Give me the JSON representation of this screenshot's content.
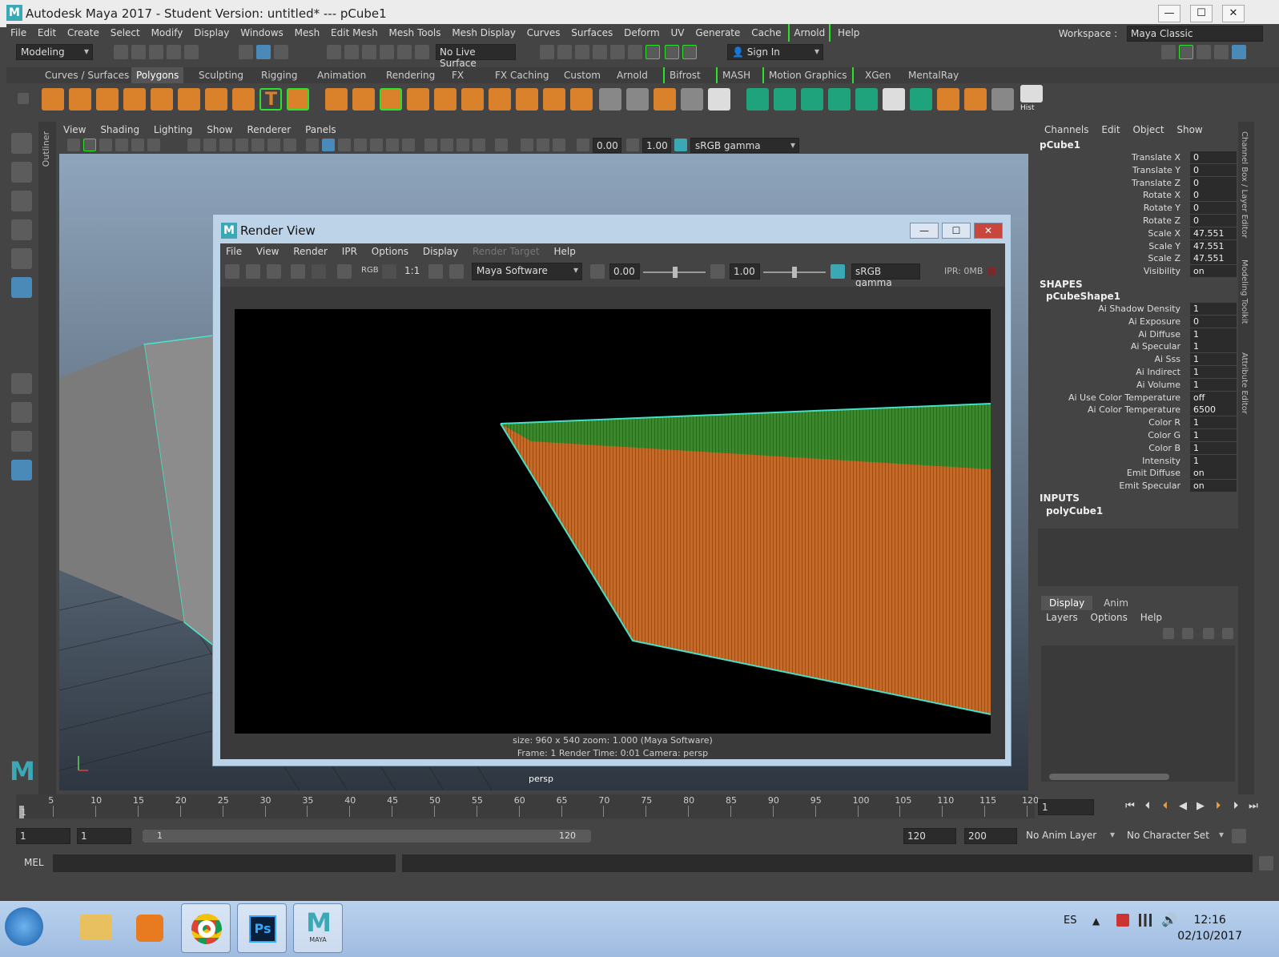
{
  "window": {
    "title": "Autodesk Maya 2017 - Student Version: untitled*   ---   pCube1",
    "logo": "M",
    "minimize": "—",
    "maximize": "☐",
    "close": "✕"
  },
  "menus": {
    "main": [
      "File",
      "Edit",
      "Create",
      "Select",
      "Modify",
      "Display",
      "Windows",
      "Mesh",
      "Edit Mesh",
      "Mesh Tools",
      "Mesh Display",
      "Curves",
      "Surfaces",
      "Deform",
      "UV",
      "Generate",
      "Cache",
      "Arnold",
      "Help"
    ],
    "workspace_label": "Workspace :",
    "workspace_value": "Maya Classic"
  },
  "statusline": {
    "mode": "Modeling",
    "live_surface": "No Live Surface",
    "sign_in": "Sign In"
  },
  "shelf": {
    "tabs": [
      "Curves / Surfaces",
      "Polygons",
      "Sculpting",
      "Rigging",
      "Animation",
      "Rendering",
      "FX",
      "FX Caching",
      "Custom",
      "Arnold",
      "Bifrost",
      "MASH",
      "Motion Graphics",
      "XGen",
      "MentalRay"
    ],
    "active_tab": "Polygons",
    "hist_label": "Hist"
  },
  "outliner_tab": "Outliner",
  "viewport": {
    "menu": [
      "View",
      "Shading",
      "Lighting",
      "Show",
      "Renderer",
      "Panels"
    ],
    "exposure": "0.00",
    "gamma": "1.00",
    "colorspace": "sRGB gamma",
    "camera_label": "persp"
  },
  "render_view": {
    "title": "Render View",
    "menu": [
      "File",
      "View",
      "Render",
      "IPR",
      "Options",
      "Display",
      "Render Target",
      "Help"
    ],
    "renderer": "Maya Software",
    "exposure": "0.00",
    "gamma": "1.00",
    "colorspace": "sRGB gamma",
    "ipr_memory": "IPR: 0MB",
    "rgb_label": "RGB",
    "ratio_label": "1:1",
    "info_line1": "size: 960 x 540  zoom: 1.000        (Maya Software)",
    "info_line2": "Frame: 1        Render Time: 0:01        Camera: persp"
  },
  "channel_box": {
    "menu": [
      "Channels",
      "Edit",
      "Object",
      "Show"
    ],
    "object": "pCube1",
    "transform": [
      {
        "label": "Translate X",
        "value": "0"
      },
      {
        "label": "Translate Y",
        "value": "0"
      },
      {
        "label": "Translate Z",
        "value": "0"
      },
      {
        "label": "Rotate X",
        "value": "0"
      },
      {
        "label": "Rotate Y",
        "value": "0"
      },
      {
        "label": "Rotate Z",
        "value": "0"
      },
      {
        "label": "Scale X",
        "value": "47.551"
      },
      {
        "label": "Scale Y",
        "value": "47.551"
      },
      {
        "label": "Scale Z",
        "value": "47.551"
      },
      {
        "label": "Visibility",
        "value": "on"
      }
    ],
    "shapes_header": "SHAPES",
    "shape_name": "pCubeShape1",
    "shape_attrs": [
      {
        "label": "Ai Shadow Density",
        "value": "1"
      },
      {
        "label": "Ai Exposure",
        "value": "0"
      },
      {
        "label": "Ai Diffuse",
        "value": "1"
      },
      {
        "label": "Ai Specular",
        "value": "1"
      },
      {
        "label": "Ai Sss",
        "value": "1"
      },
      {
        "label": "Ai Indirect",
        "value": "1"
      },
      {
        "label": "Ai Volume",
        "value": "1"
      },
      {
        "label": "Ai Use Color Temperature",
        "value": "off"
      },
      {
        "label": "Ai Color Temperature",
        "value": "6500"
      },
      {
        "label": "Color R",
        "value": "1"
      },
      {
        "label": "Color G",
        "value": "1"
      },
      {
        "label": "Color B",
        "value": "1"
      },
      {
        "label": "Intensity",
        "value": "1"
      },
      {
        "label": "Emit Diffuse",
        "value": "on"
      },
      {
        "label": "Emit Specular",
        "value": "on"
      }
    ],
    "inputs_header": "INPUTS",
    "input_name": "polyCube1"
  },
  "side_tabs": [
    "Channel Box / Layer Editor",
    "Modeling Toolkit",
    "Attribute Editor"
  ],
  "layer_editor": {
    "tabs": [
      "Display",
      "Anim"
    ],
    "active_tab": "Display",
    "menu": [
      "Layers",
      "Options",
      "Help"
    ]
  },
  "timeline": {
    "ticks": [
      "5",
      "10",
      "15",
      "20",
      "25",
      "30",
      "35",
      "40",
      "45",
      "50",
      "55",
      "60",
      "65",
      "70",
      "75",
      "80",
      "85",
      "90",
      "95",
      "100",
      "105",
      "110",
      "115",
      "120"
    ],
    "first_frame_label": "1",
    "current_frame": "1",
    "range_start": "1",
    "range_inner_start": "1",
    "range_slider_start": "1",
    "range_slider_end": "120",
    "range_end": "120",
    "anim_end": "200",
    "anim_layer": "No Anim Layer",
    "character_set": "No Character Set"
  },
  "command_line": {
    "label": "MEL"
  },
  "taskbar": {
    "language": "ES",
    "time": "12:16",
    "date": "02/10/2017",
    "maya_label": "MAYA",
    "ps_label": "Ps"
  }
}
